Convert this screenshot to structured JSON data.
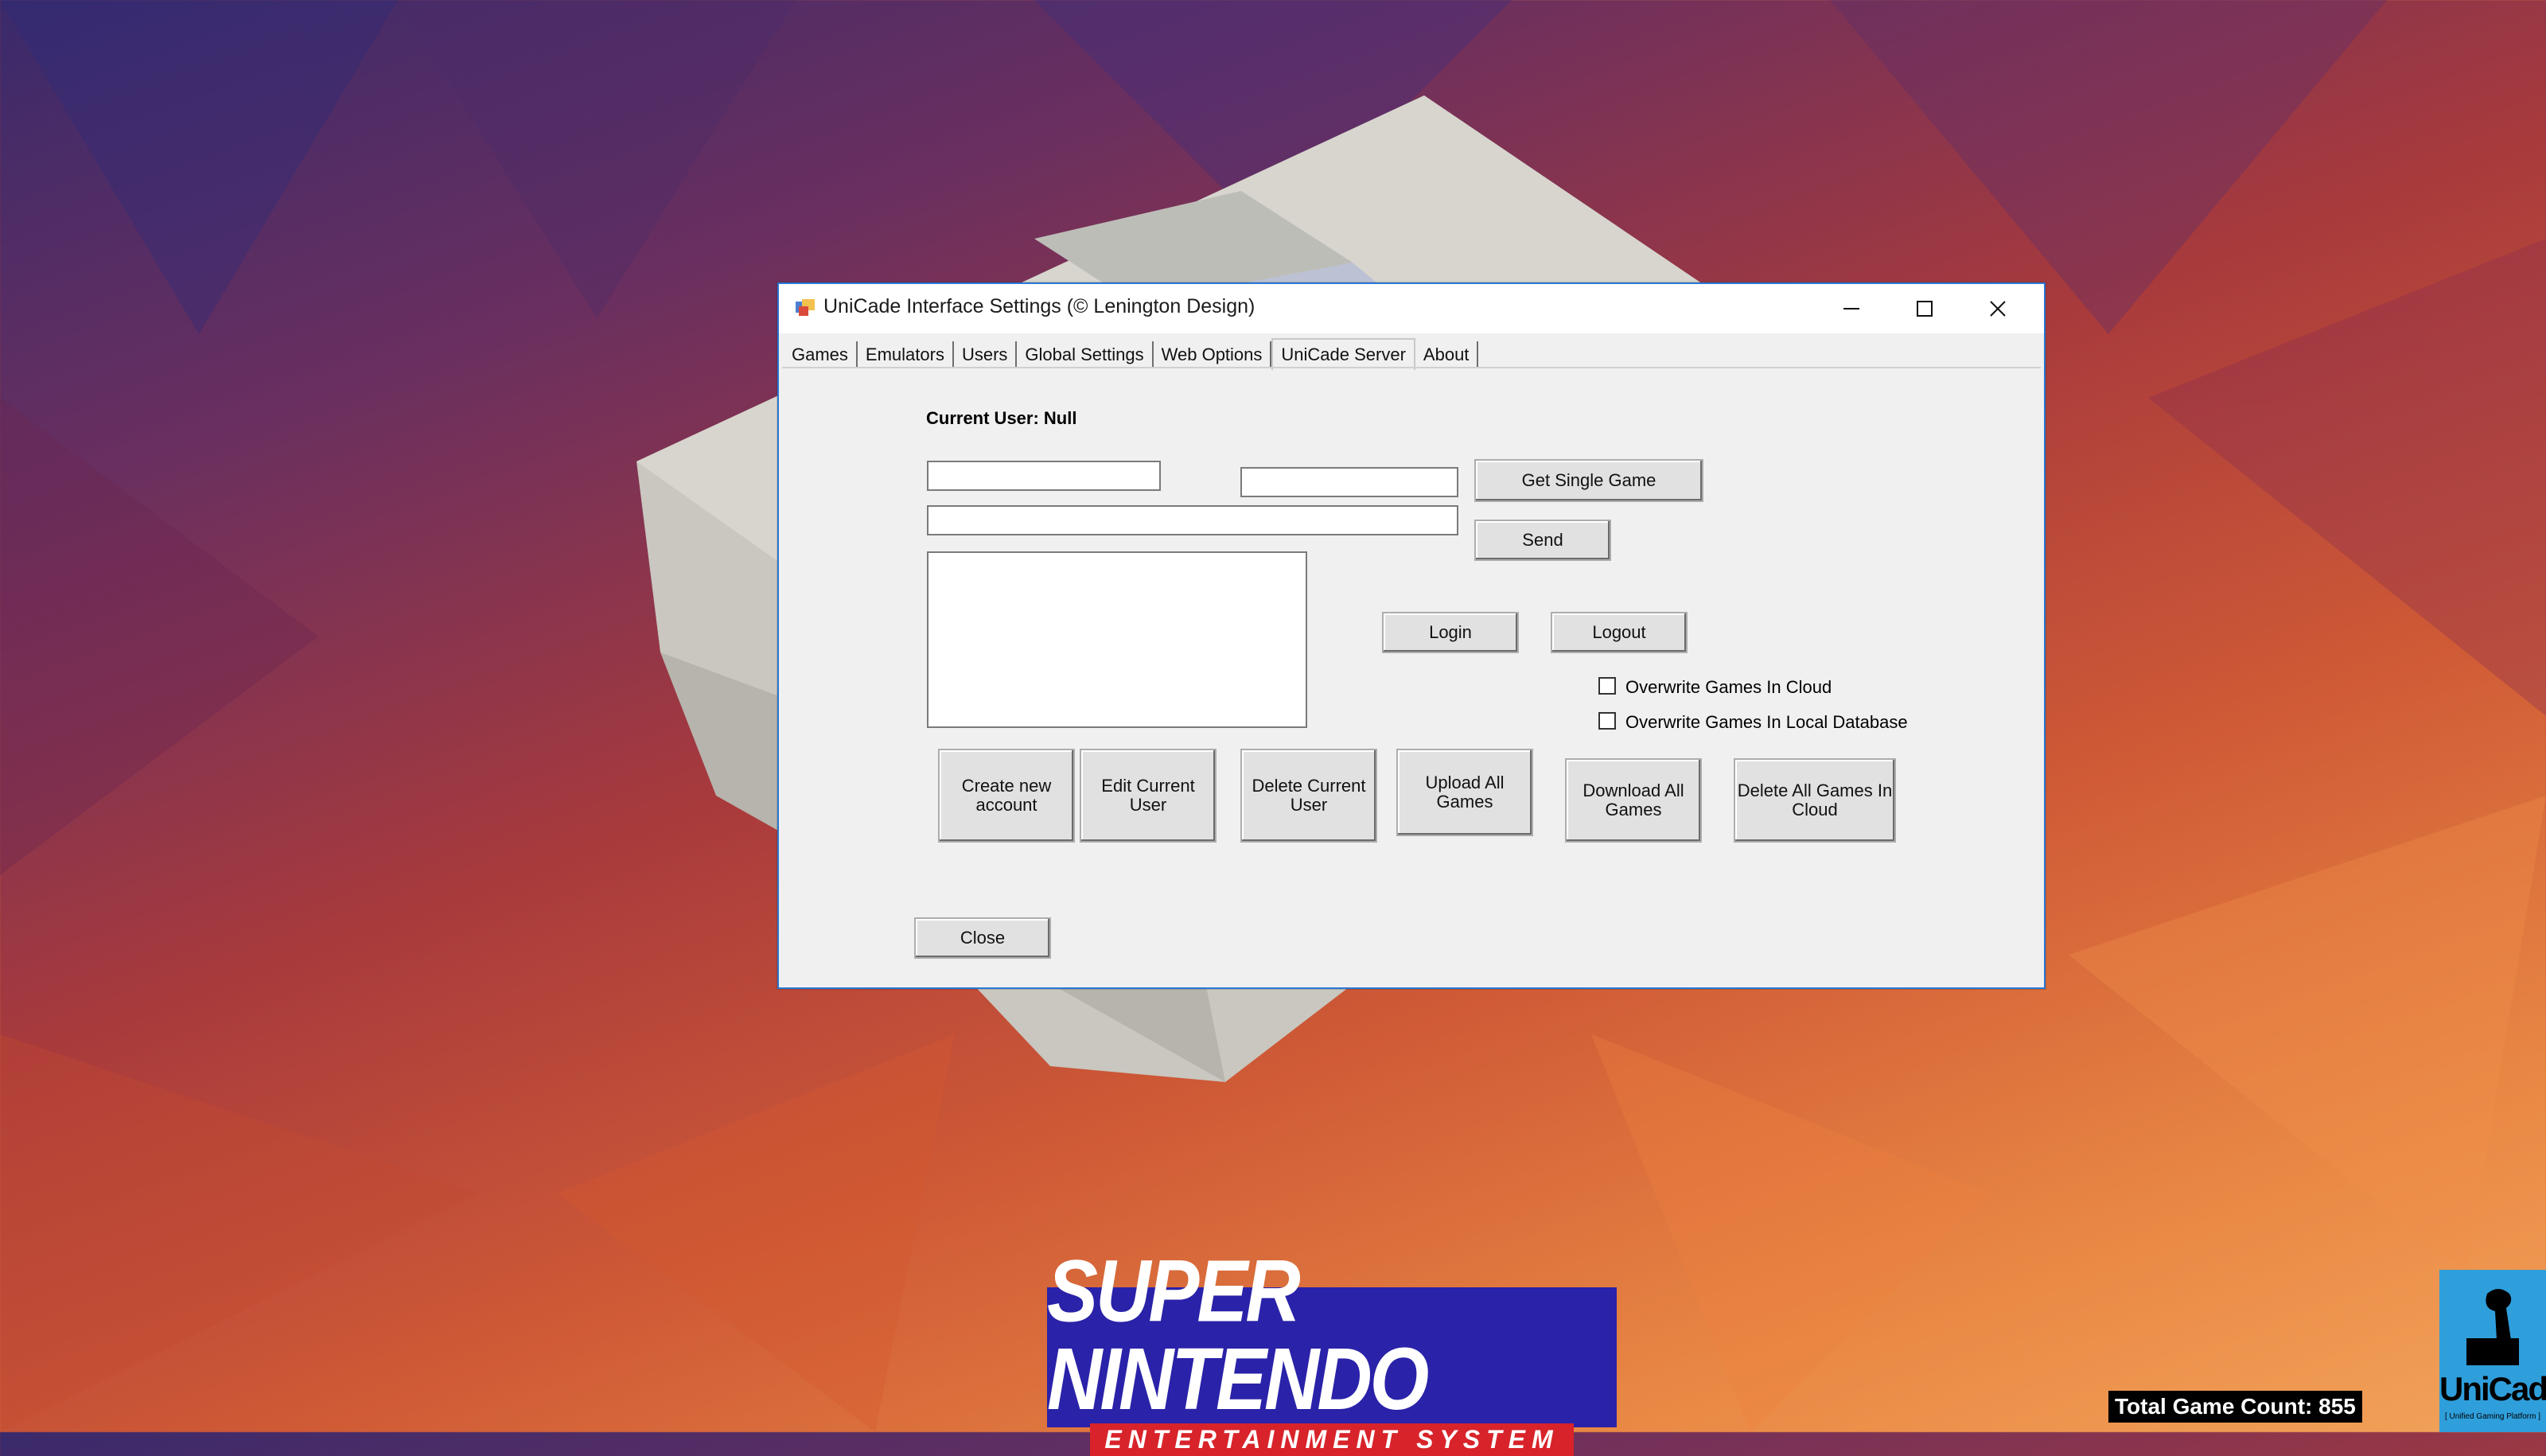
{
  "window": {
    "title": "UniCade Interface Settings (© Lenington Design)",
    "controls": [
      "minimize",
      "maximize",
      "close"
    ]
  },
  "tabs": [
    {
      "label": "Games",
      "active": false
    },
    {
      "label": "Emulators",
      "active": false
    },
    {
      "label": "Users",
      "active": false
    },
    {
      "label": "Global Settings",
      "active": false
    },
    {
      "label": "Web Options",
      "active": false
    },
    {
      "label": "UniCade Server",
      "active": true
    },
    {
      "label": "About",
      "active": false
    }
  ],
  "server": {
    "current_user_label": "Current User: Null",
    "get_single_game": "Get Single Game",
    "send": "Send",
    "login": "Login",
    "logout": "Logout",
    "overwrite_cloud": "Overwrite Games In Cloud",
    "overwrite_local": "Overwrite Games In Local Database",
    "create_account": "Create new account",
    "edit_user": "Edit Current User",
    "delete_user": "Delete Current User",
    "upload_all": "Upload All Games",
    "download_all": "Download All Games",
    "delete_cloud": "Delete All Games In Cloud",
    "close": "Close",
    "overwrite_cloud_checked": false,
    "overwrite_local_checked": false
  },
  "logos": {
    "snes_top": "SUPER NINTENDO",
    "snes_bottom": "ENTERTAINMENT SYSTEM",
    "unicade": "UniCade",
    "unicade_sub": "[ Unified Gaming Platform ]"
  },
  "status": {
    "game_count": "Total Game Count: 855"
  },
  "colors": {
    "window_border": "#2b78d4",
    "snes_blue": "#2a22a8",
    "snes_red": "#d8232a",
    "unicade_blue": "#2f9fdc"
  }
}
